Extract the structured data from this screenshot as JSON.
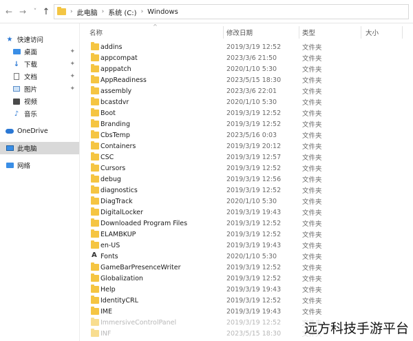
{
  "address": {
    "back_icon": "←",
    "forward_icon": "→",
    "recent_icon": "˅",
    "up_icon": "↑",
    "crumbs": [
      "此电脑",
      "系统 (C:)",
      "Windows"
    ],
    "separator": "›"
  },
  "sidebar": {
    "quick_access": "快速访问",
    "items": [
      {
        "label": "桌面",
        "icon": "desktop-icon",
        "pinned": true
      },
      {
        "label": "下载",
        "icon": "download-icon",
        "pinned": true
      },
      {
        "label": "文档",
        "icon": "document-icon",
        "pinned": true
      },
      {
        "label": "图片",
        "icon": "picture-icon",
        "pinned": true
      },
      {
        "label": "视频",
        "icon": "video-icon",
        "pinned": false
      },
      {
        "label": "音乐",
        "icon": "music-icon",
        "pinned": false
      }
    ],
    "onedrive": "OneDrive",
    "this_pc": "此电脑",
    "network": "网络",
    "pin_glyph": "✦"
  },
  "columns": {
    "name": "名称",
    "modified": "修改日期",
    "type": "类型",
    "size": "大小",
    "sort_glyph": "^"
  },
  "files": [
    {
      "name": "addins",
      "date": "2019/3/19 12:52",
      "type": "文件夹"
    },
    {
      "name": "appcompat",
      "date": "2023/3/6 21:50",
      "type": "文件夹"
    },
    {
      "name": "apppatch",
      "date": "2020/1/10 5:30",
      "type": "文件夹"
    },
    {
      "name": "AppReadiness",
      "date": "2023/5/15 18:30",
      "type": "文件夹"
    },
    {
      "name": "assembly",
      "date": "2023/3/6 22:01",
      "type": "文件夹"
    },
    {
      "name": "bcastdvr",
      "date": "2020/1/10 5:30",
      "type": "文件夹"
    },
    {
      "name": "Boot",
      "date": "2019/3/19 12:52",
      "type": "文件夹"
    },
    {
      "name": "Branding",
      "date": "2019/3/19 12:52",
      "type": "文件夹"
    },
    {
      "name": "CbsTemp",
      "date": "2023/5/16 0:03",
      "type": "文件夹"
    },
    {
      "name": "Containers",
      "date": "2019/3/19 20:12",
      "type": "文件夹"
    },
    {
      "name": "CSC",
      "date": "2019/3/19 12:57",
      "type": "文件夹"
    },
    {
      "name": "Cursors",
      "date": "2019/3/19 12:52",
      "type": "文件夹"
    },
    {
      "name": "debug",
      "date": "2019/3/19 12:56",
      "type": "文件夹"
    },
    {
      "name": "diagnostics",
      "date": "2019/3/19 12:52",
      "type": "文件夹"
    },
    {
      "name": "DiagTrack",
      "date": "2020/1/10 5:30",
      "type": "文件夹"
    },
    {
      "name": "DigitalLocker",
      "date": "2019/3/19 19:43",
      "type": "文件夹"
    },
    {
      "name": "Downloaded Program Files",
      "date": "2019/3/19 12:52",
      "type": "文件夹"
    },
    {
      "name": "ELAMBKUP",
      "date": "2019/3/19 12:52",
      "type": "文件夹"
    },
    {
      "name": "en-US",
      "date": "2019/3/19 19:43",
      "type": "文件夹"
    },
    {
      "name": "Fonts",
      "date": "2020/1/10 5:30",
      "type": "文件夹",
      "system": true
    },
    {
      "name": "GameBarPresenceWriter",
      "date": "2019/3/19 12:52",
      "type": "文件夹"
    },
    {
      "name": "Globalization",
      "date": "2019/3/19 12:52",
      "type": "文件夹"
    },
    {
      "name": "Help",
      "date": "2019/3/19 19:43",
      "type": "文件夹"
    },
    {
      "name": "IdentityCRL",
      "date": "2019/3/19 12:52",
      "type": "文件夹"
    },
    {
      "name": "IME",
      "date": "2019/3/19 19:43",
      "type": "文件夹"
    },
    {
      "name": "ImmersiveControlPanel",
      "date": "2019/3/19 12:52",
      "type": "文件夹",
      "dim": true
    },
    {
      "name": "INF",
      "date": "2023/5/15 18:30",
      "type": "文件夹",
      "dim": true
    }
  ],
  "watermark": "远方科技手游平台"
}
